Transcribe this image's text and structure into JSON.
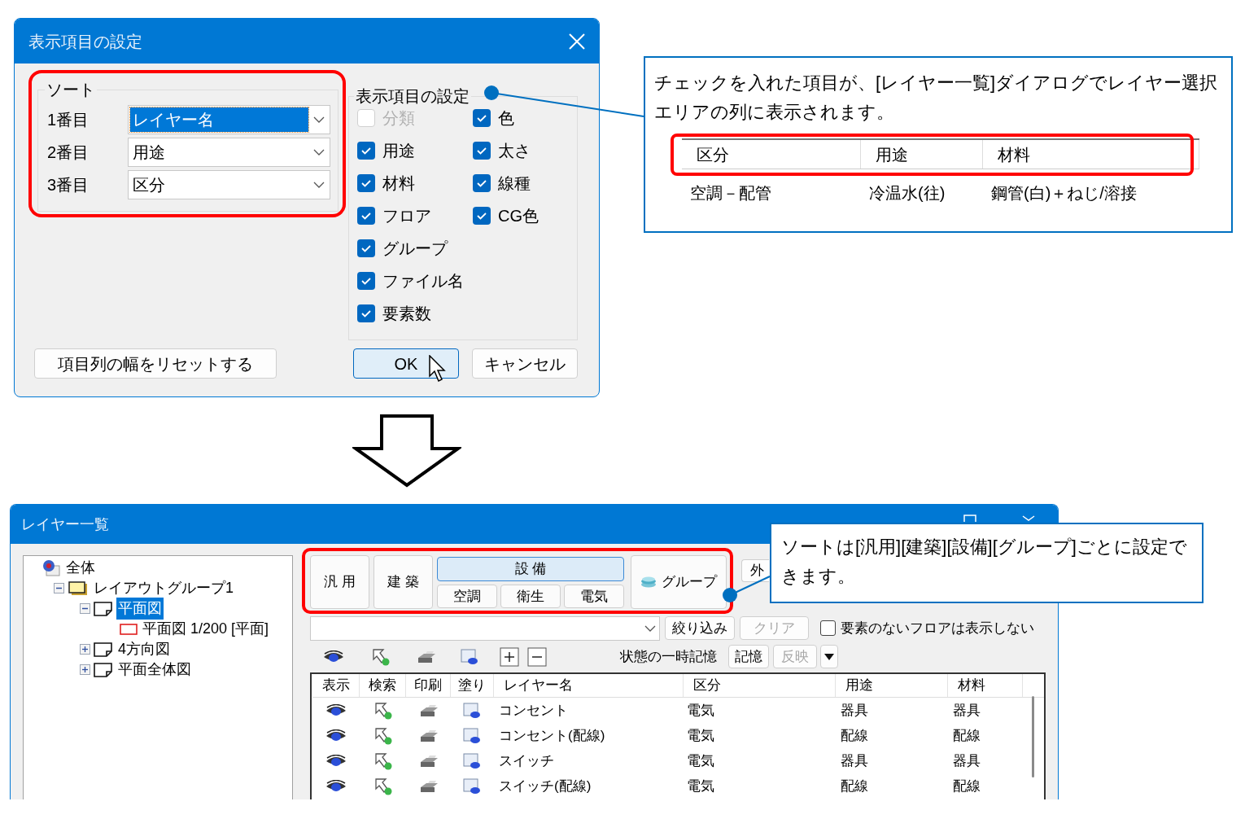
{
  "settings_dialog": {
    "title": "表示項目の設定",
    "sort": {
      "label": "ソート",
      "rows": [
        {
          "label": "1番目",
          "value": "レイヤー名",
          "selected": true
        },
        {
          "label": "2番目",
          "value": "用途",
          "selected": false
        },
        {
          "label": "3番目",
          "value": "区分",
          "selected": false
        }
      ]
    },
    "display_items": {
      "label": "表示項目の設定",
      "left_column": [
        {
          "label": "分類",
          "checked": false,
          "disabled": true
        },
        {
          "label": "用途",
          "checked": true,
          "disabled": false
        },
        {
          "label": "材料",
          "checked": true,
          "disabled": false
        },
        {
          "label": "フロア",
          "checked": true,
          "disabled": false
        },
        {
          "label": "グループ",
          "checked": true,
          "disabled": false
        },
        {
          "label": "ファイル名",
          "checked": true,
          "disabled": false
        },
        {
          "label": "要素数",
          "checked": true,
          "disabled": false
        }
      ],
      "right_column": [
        {
          "label": "色",
          "checked": true,
          "disabled": false
        },
        {
          "label": "太さ",
          "checked": true,
          "disabled": false
        },
        {
          "label": "線種",
          "checked": true,
          "disabled": false
        },
        {
          "label": "CG色",
          "checked": true,
          "disabled": false
        }
      ]
    },
    "buttons": [
      {
        "label": "項目列の幅をリセットする",
        "kind": "reset"
      },
      {
        "label": "OK",
        "kind": "default"
      },
      {
        "label": "キャンセル",
        "kind": "cancel"
      }
    ]
  },
  "callout_top": {
    "text": "チェックを入れた項目が、[レイヤー一覧]ダイアログでレイヤー選択エリアの列に表示されます。",
    "table": {
      "columns": [
        "区分",
        "用途",
        "材料"
      ],
      "rows": [
        [
          "空調－配管",
          "冷温水(往)",
          "鋼管(白)＋ねじ/溶接"
        ]
      ]
    }
  },
  "layer_window": {
    "title": "レイヤー一覧",
    "tree": [
      {
        "label": "全体",
        "kind": "root",
        "selected": false,
        "children": [
          {
            "label": "レイアウトグループ1",
            "kind": "folder",
            "selected": false,
            "expanded": true,
            "children": [
              {
                "label": "平面図",
                "kind": "sheet",
                "selected": true,
                "expanded": true,
                "children": [
                  {
                    "label": "平面図 1/200 [平面]",
                    "kind": "view",
                    "selected": false
                  }
                ]
              },
              {
                "label": "4方向図",
                "kind": "sheet",
                "selected": false,
                "expanded": false
              },
              {
                "label": "平面全体図",
                "kind": "sheet",
                "selected": false,
                "expanded": false
              }
            ]
          }
        ]
      }
    ],
    "group_tabs": [
      {
        "label": "汎 用",
        "selected": false
      },
      {
        "label": "建 築",
        "selected": false
      },
      {
        "label": "設 備",
        "selected": true,
        "subtabs": [
          {
            "label": "空調",
            "selected": false
          },
          {
            "label": "衛生",
            "selected": false
          },
          {
            "label": "電気",
            "selected": false
          }
        ]
      },
      {
        "label": "グループ",
        "selected": false
      }
    ],
    "outside_button": "外",
    "filter_button": "絞り込み",
    "clear_button": {
      "label": "クリア",
      "disabled": true
    },
    "hide_empty_floors": {
      "label": "要素のないフロアは表示しない",
      "checked": false
    },
    "state_label": "状態の一時記憶",
    "memory_button": {
      "label": "記憶",
      "disabled": false
    },
    "apply_button": {
      "label": "反映",
      "disabled": true
    },
    "columns": [
      "表示",
      "検索",
      "印刷",
      "塗り",
      "レイヤー名",
      "区分",
      "用途",
      "材料"
    ],
    "rows": [
      {
        "name": "コンセント",
        "category": "電気",
        "use": "器具",
        "material": "器具"
      },
      {
        "name": "コンセント(配線)",
        "category": "電気",
        "use": "配線",
        "material": "配線"
      },
      {
        "name": "スイッチ",
        "category": "電気",
        "use": "器具",
        "material": "器具"
      },
      {
        "name": "スイッチ(配線)",
        "category": "電気",
        "use": "配線",
        "material": "配線"
      }
    ]
  },
  "callout_bottom": {
    "text": "ソートは[汎用][建築][設備][グループ]ごとに設定できます。"
  }
}
